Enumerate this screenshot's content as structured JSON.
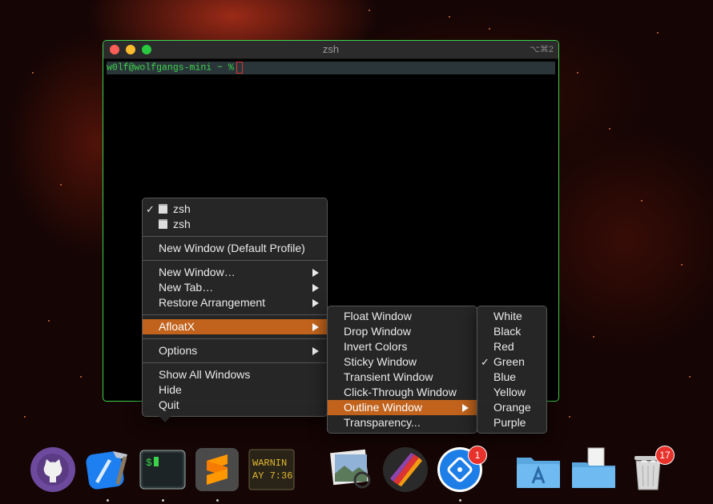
{
  "terminal": {
    "title": "zsh",
    "shortcut": "⌥⌘2",
    "prompt": "w0lf@wolfgangs-mini ~ %"
  },
  "menu_main": {
    "windows": [
      {
        "label": "zsh",
        "checked": true
      },
      {
        "label": "zsh",
        "checked": false
      }
    ],
    "new_window_default": "New Window (Default Profile)",
    "new_window": "New Window…",
    "new_tab": "New Tab…",
    "restore_arrangement": "Restore Arrangement",
    "afloatx": "AfloatX",
    "options": "Options",
    "show_all_windows": "Show All Windows",
    "hide": "Hide",
    "quit": "Quit"
  },
  "menu_afloat": {
    "items": [
      "Float Window",
      "Drop Window",
      "Invert Colors",
      "Sticky Window",
      "Transient Window",
      "Click-Through Window",
      "Outline Window",
      "Transparency..."
    ]
  },
  "menu_colors": {
    "items": [
      "White",
      "Black",
      "Red",
      "Green",
      "Blue",
      "Yellow",
      "Orange",
      "Purple"
    ],
    "selected": "Green"
  },
  "dock": {
    "console_text_line1": "WARNIN",
    "console_text_line2": "AY 7:36",
    "badge_app": "1",
    "badge_trash": "17",
    "icons": [
      "github-desktop-icon",
      "xcode-icon",
      "terminal-icon",
      "sublime-text-icon",
      "console-icon",
      "preview-icon",
      "dark-mode-icon",
      "app-icon",
      "applications-folder-icon",
      "downloads-folder-icon",
      "trash-icon"
    ]
  },
  "colors": {
    "accent": "#c1631c",
    "terminal_border": "#3cd44a",
    "prompt": "#3cd44a"
  }
}
